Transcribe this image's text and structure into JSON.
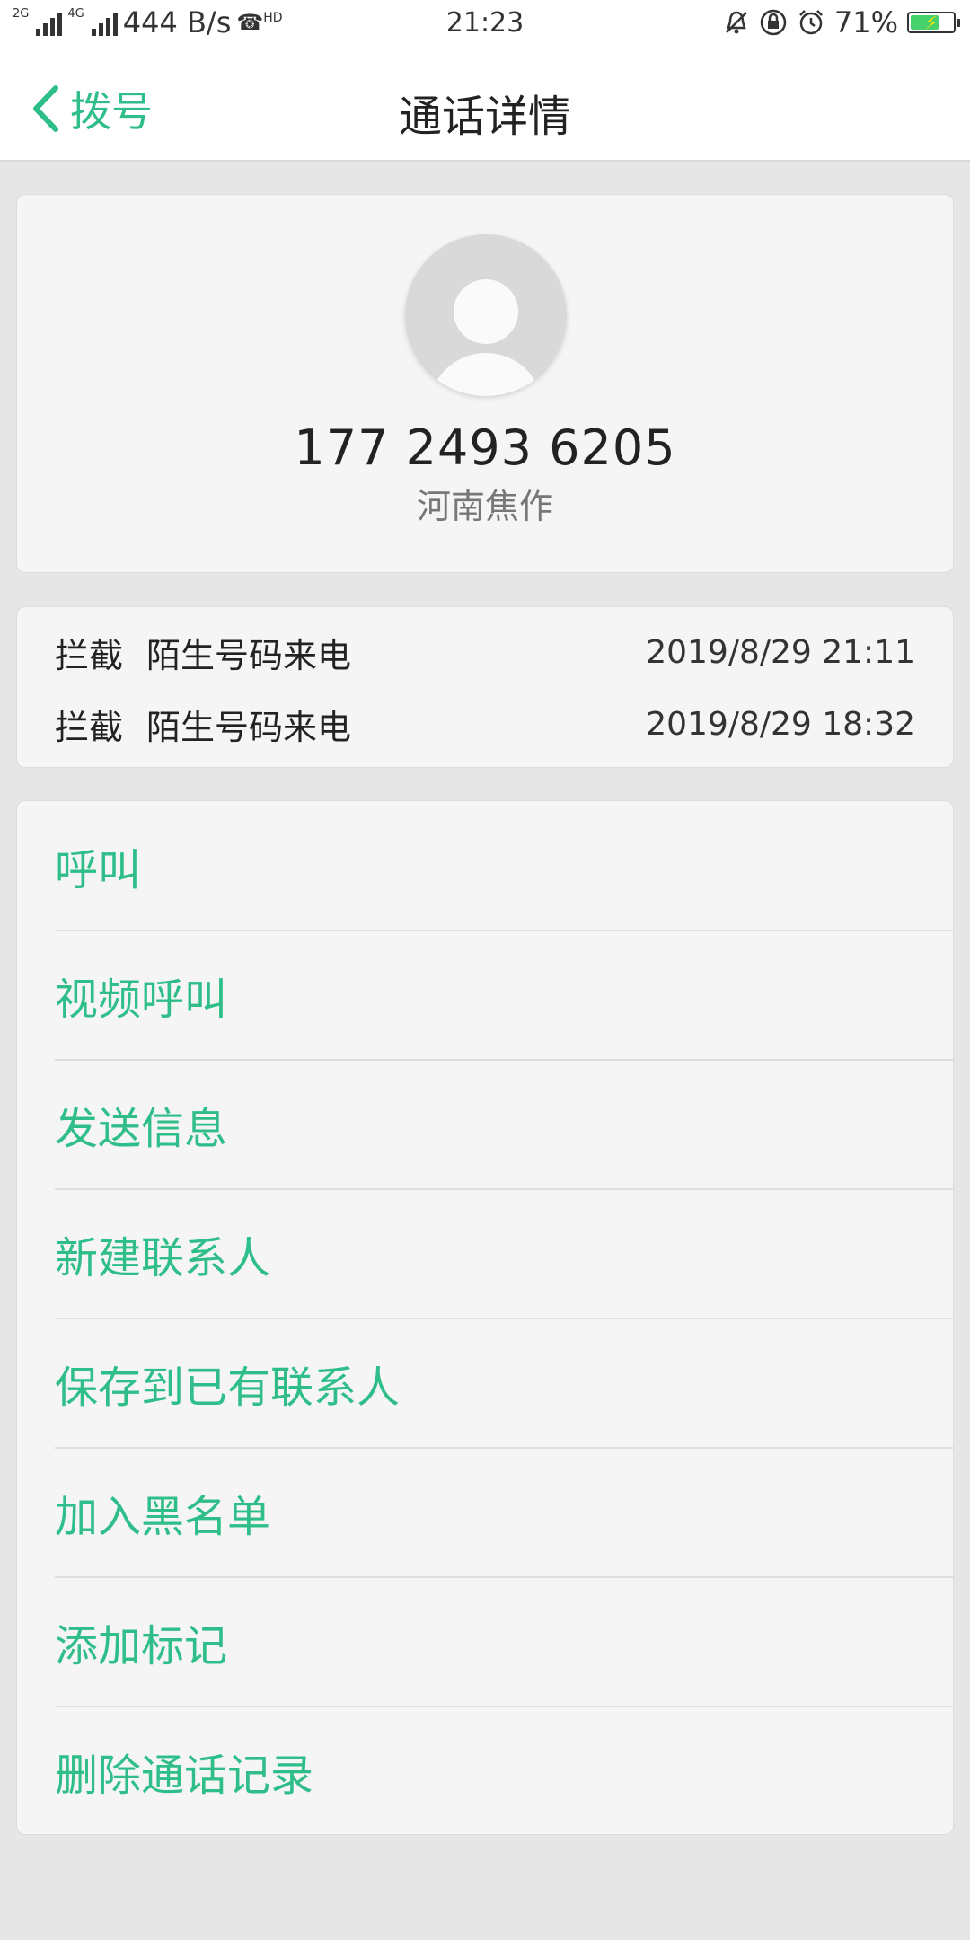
{
  "status_bar": {
    "network_1": "2G",
    "network_2": "4G",
    "speed": "444 B/s",
    "hd": "HD",
    "time": "21:23",
    "battery": "71%",
    "battery_level": 0.71,
    "icons": [
      "bell-off-icon",
      "lock-rotation-icon",
      "alarm-icon",
      "battery-charging-icon"
    ]
  },
  "header": {
    "back_label": "拨号",
    "title": "通话详情"
  },
  "contact": {
    "number": "177 2493 6205",
    "location": "河南焦作"
  },
  "call_log": [
    {
      "type": "拦截",
      "label": "陌生号码来电",
      "datetime": "2019/8/29 21:11"
    },
    {
      "type": "拦截",
      "label": "陌生号码来电",
      "datetime": "2019/8/29 18:32"
    }
  ],
  "actions": [
    {
      "label": "呼叫"
    },
    {
      "label": "视频呼叫"
    },
    {
      "label": "发送信息"
    },
    {
      "label": "新建联系人"
    },
    {
      "label": "保存到已有联系人"
    },
    {
      "label": "加入黑名单"
    },
    {
      "label": "添加标记"
    },
    {
      "label": "删除通话记录"
    }
  ],
  "colors": {
    "accent": "#2fbe8a",
    "background": "#e6e6e6",
    "card": "#f5f5f5"
  }
}
